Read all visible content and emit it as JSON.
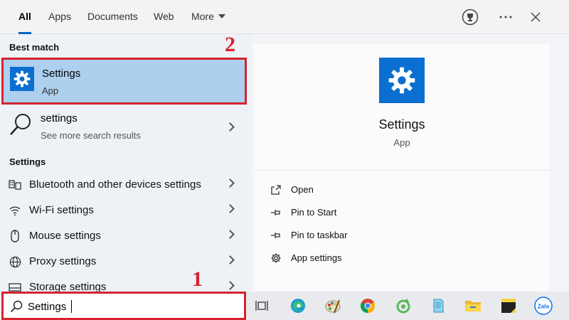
{
  "tabs": [
    {
      "label": "All",
      "active": true
    },
    {
      "label": "Apps"
    },
    {
      "label": "Documents"
    },
    {
      "label": "Web"
    },
    {
      "label": "More"
    }
  ],
  "header_icons": [
    "trophy-icon",
    "more-options-icon",
    "close-icon"
  ],
  "best_match": {
    "section_label": "Best match",
    "title": "Settings",
    "subtitle": "App",
    "icon": "gear-icon"
  },
  "web_result": {
    "title": "settings",
    "subtitle": "See more search results",
    "icon": "search-icon"
  },
  "settings_section": {
    "label": "Settings",
    "items": [
      {
        "label": "Bluetooth and other devices settings",
        "icon": "devices-icon"
      },
      {
        "label": "Wi-Fi settings",
        "icon": "wifi-icon"
      },
      {
        "label": "Mouse settings",
        "icon": "mouse-icon"
      },
      {
        "label": "Proxy settings",
        "icon": "globe-icon"
      },
      {
        "label": "Storage settings",
        "icon": "storage-icon"
      }
    ]
  },
  "details": {
    "title": "Settings",
    "subtitle": "App",
    "actions": [
      {
        "label": "Open",
        "icon": "open-icon"
      },
      {
        "label": "Pin to Start",
        "icon": "pin-icon"
      },
      {
        "label": "Pin to taskbar",
        "icon": "pin-icon"
      },
      {
        "label": "App settings",
        "icon": "gear-icon"
      }
    ]
  },
  "search": {
    "value": "Settings"
  },
  "markers": {
    "one": "1",
    "two": "2"
  },
  "taskbar_icons": [
    "task-view-icon",
    "edge-icon",
    "paint-icon",
    "chrome-icon",
    "app-icon",
    "notepad-icon",
    "file-explorer-icon",
    "sticky-notes-icon",
    "zalo-icon"
  ],
  "taskbar_text": {
    "zalo": "Zalo"
  },
  "colors": {
    "accent": "#0067c0",
    "tile": "#0a6fd0",
    "selection": "#acd0ed",
    "annotation": "#d5232f"
  }
}
